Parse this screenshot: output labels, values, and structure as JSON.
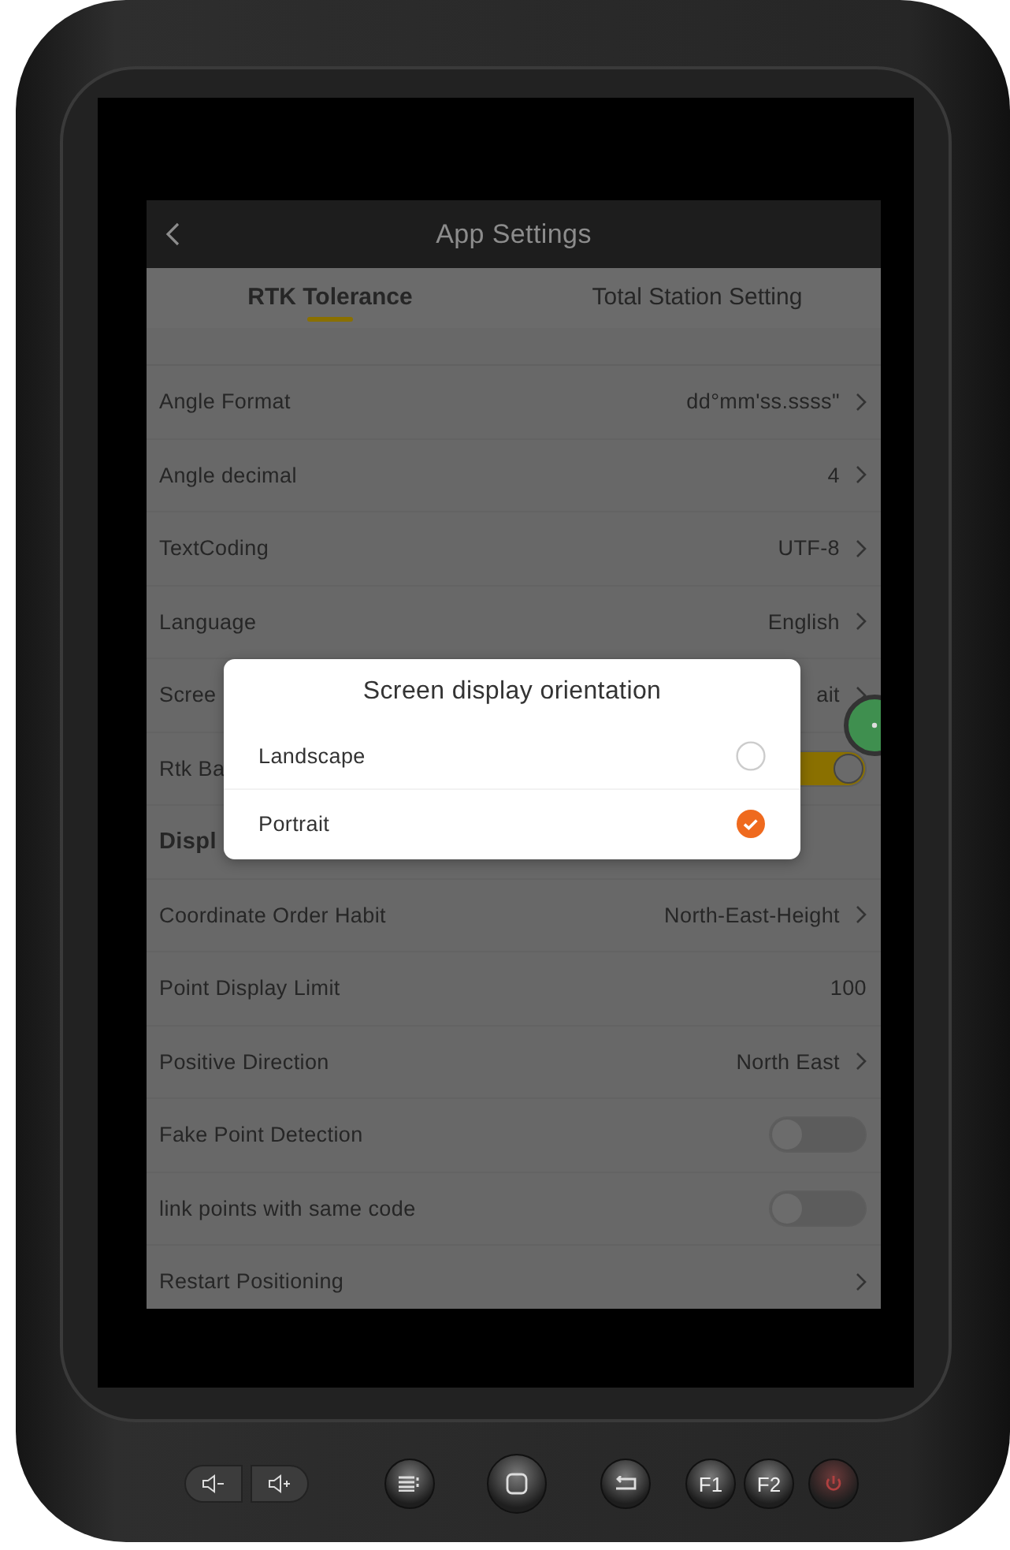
{
  "header": {
    "title": "App Settings"
  },
  "tabs": [
    {
      "label": "RTK Tolerance",
      "selected": true
    },
    {
      "label": "Total Station Setting",
      "selected": false
    }
  ],
  "rows": [
    {
      "kind": "value",
      "label": "Angle Format",
      "value": "dd°mm'ss.ssss\""
    },
    {
      "kind": "value",
      "label": "Angle decimal",
      "value": "4"
    },
    {
      "kind": "value",
      "label": "TextCoding",
      "value": "UTF-8"
    },
    {
      "kind": "value",
      "label": "Language",
      "value": "English"
    },
    {
      "kind": "value",
      "label": "Scree",
      "value": "ait"
    },
    {
      "kind": "toggle",
      "label": "Rtk Ba",
      "on": true
    },
    {
      "kind": "section",
      "label": "Displ"
    },
    {
      "kind": "value",
      "label": "Coordinate Order Habit",
      "value": "North-East-Height"
    },
    {
      "kind": "plain",
      "label": "Point Display Limit",
      "value": "100"
    },
    {
      "kind": "value",
      "label": "Positive Direction",
      "value": "North East"
    },
    {
      "kind": "toggle",
      "label": "Fake Point Detection",
      "on": false
    },
    {
      "kind": "toggle",
      "label": "link points with same code",
      "on": false
    },
    {
      "kind": "link",
      "label": "Restart Positioning"
    }
  ],
  "dialog": {
    "title": "Screen display orientation",
    "options": [
      {
        "label": "Landscape",
        "selected": false
      },
      {
        "label": "Portrait",
        "selected": true
      }
    ]
  },
  "function_keys": [
    "F1",
    "F2"
  ]
}
